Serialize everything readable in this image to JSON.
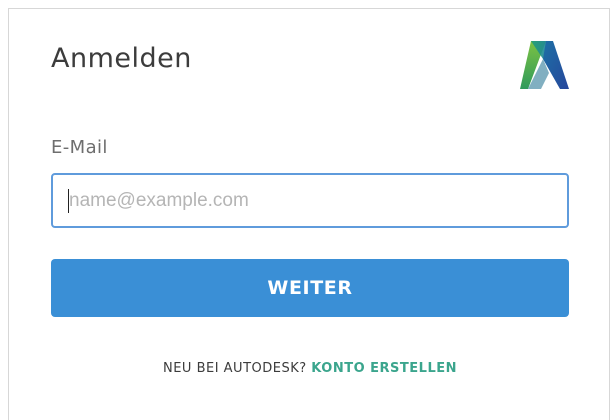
{
  "header": {
    "title": "Anmelden",
    "logo_name": "autodesk-logo"
  },
  "form": {
    "email_label": "E-Mail",
    "email_value": "",
    "email_placeholder": "name@example.com",
    "continue_label": "WEITER"
  },
  "footer": {
    "prompt": "NEU BEI AUTODESK?",
    "signup_link": "KONTO ERSTELLEN"
  },
  "colors": {
    "primary_button": "#3a8fd6",
    "input_focus_border": "#5f9bdc",
    "link": "#3ba58d",
    "title_text": "#3c3c3c"
  }
}
